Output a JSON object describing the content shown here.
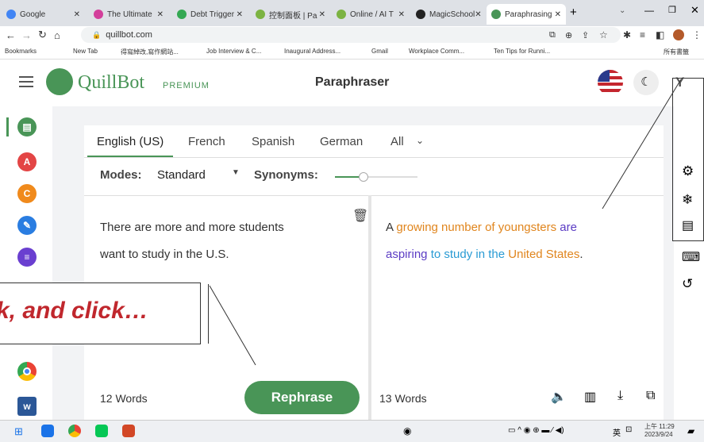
{
  "tabs": [
    {
      "label": "Google",
      "color": "#4285f4"
    },
    {
      "label": "The Ultimate",
      "color": "#d33f9b"
    },
    {
      "label": "Debt Trigger",
      "color": "#34a853"
    },
    {
      "label": "控制面板 | Pa",
      "color": "#7cb342"
    },
    {
      "label": "Online / AI T",
      "color": "#7cb342"
    },
    {
      "label": "MagicSchool",
      "color": "#222"
    },
    {
      "label": "Paraphrasing",
      "color": "#499557"
    }
  ],
  "address": "quillbot.com",
  "bookmarks": [
    "Bookmarks",
    "New Tab",
    "得寫綽改,寫作網站...",
    "Job Interview & C...",
    "Inaugural Address...",
    "Gmail",
    "Workplace Comm...",
    "Ten Tips for Runni...",
    "所有書籤"
  ],
  "header": {
    "brand": "QuillBot",
    "premium": "PREMIUM",
    "title": "Paraphraser",
    "avatar": "Y"
  },
  "languages": [
    "English (US)",
    "French",
    "Spanish",
    "German",
    "All"
  ],
  "modes": {
    "label": "Modes:",
    "value": "Standard",
    "synonyms": "Synonyms:"
  },
  "input": {
    "line1": "There are more and more students",
    "line2": "want to study in the U.S.",
    "words": "12 Words"
  },
  "output": {
    "segments": [
      {
        "text": "A ",
        "color": "#333"
      },
      {
        "text": "growing number of youngsters",
        "color": "#e0851d"
      },
      {
        "text": " are",
        "color": "#5b3cc4"
      },
      {
        "text": "aspiring",
        "color": "#5b3cc4"
      },
      {
        "text": " to study in the ",
        "color": "#2a9bd4"
      },
      {
        "text": "United States",
        "color": "#e0851d"
      },
      {
        "text": ".",
        "color": "#333"
      }
    ],
    "words": "13 Words"
  },
  "rephrase": "Rephrase",
  "callout": "k, and click…",
  "clock": {
    "time": "上午 11:29",
    "date": "2023/9/24"
  },
  "taskbar_lang": "英",
  "colors": {
    "brand": "#499557",
    "accent": "#499557"
  }
}
